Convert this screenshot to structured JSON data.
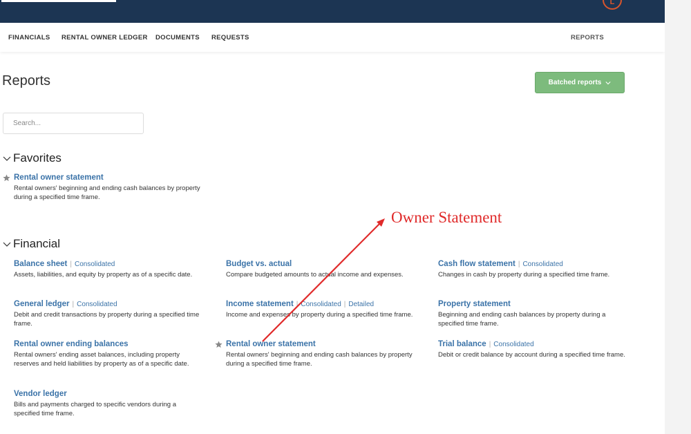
{
  "header": {
    "user_initial": "L"
  },
  "nav": {
    "financials": "FINANCIALS",
    "rental_owner_ledger": "RENTAL OWNER LEDGER",
    "documents": "DOCUMENTS",
    "requests": "REQUESTS",
    "reports": "REPORTS"
  },
  "page": {
    "title": "Reports",
    "batched_button": "Batched reports",
    "search_placeholder": "Search..."
  },
  "favorites": {
    "title": "Favorites",
    "items": [
      {
        "name": "Rental owner statement",
        "desc": "Rental owners' beginning and ending cash balances by property during a specified time frame."
      }
    ]
  },
  "financial": {
    "title": "Financial",
    "items": [
      {
        "name": "Balance sheet",
        "tags": [
          "Consolidated"
        ],
        "desc": "Assets, liabilities, and equity by property as of a specific date."
      },
      {
        "name": "Budget vs. actual",
        "tags": [],
        "desc": "Compare budgeted amounts to actual income and expenses."
      },
      {
        "name": "Cash flow statement",
        "tags": [
          "Consolidated"
        ],
        "desc": "Changes in cash by property during a specified time frame."
      },
      {
        "name": "General ledger",
        "tags": [
          "Consolidated"
        ],
        "desc": "Debit and credit transactions by property during a specified time frame."
      },
      {
        "name": "Income statement",
        "tags": [
          "Consolidated",
          "Detailed"
        ],
        "desc": "Income and expenses by property during a specified time frame."
      },
      {
        "name": "Property statement",
        "tags": [],
        "desc": "Beginning and ending cash balances by property during a specified time frame."
      },
      {
        "name": "Rental owner ending balances",
        "tags": [],
        "desc": "Rental owners' ending asset balances, including property reserves and held liabilities by property as of a specific date."
      },
      {
        "name": "Rental owner statement",
        "tags": [],
        "desc": "Rental owners' beginning and ending cash balances by property during a specified time frame."
      },
      {
        "name": "Trial balance",
        "tags": [
          "Consolidated"
        ],
        "desc": "Debit or credit balance by account during a specified time frame."
      },
      {
        "name": "Vendor ledger",
        "tags": [],
        "desc": "Bills and payments charged to specific vendors during a specified time frame."
      }
    ]
  },
  "annotation": {
    "label": "Owner Statement",
    "color": "#e02a2a"
  }
}
